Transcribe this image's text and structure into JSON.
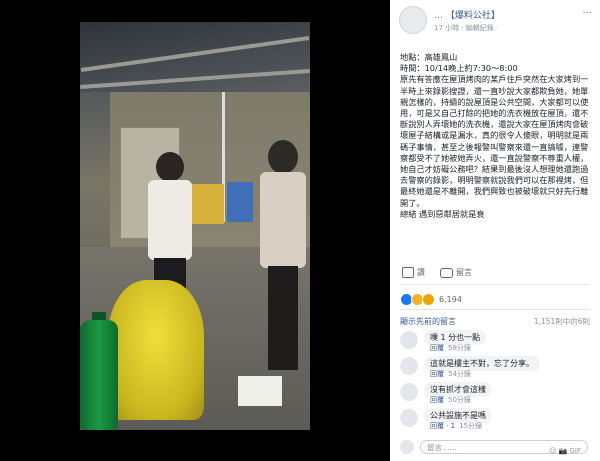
{
  "page": {
    "name": "Facebook photo/video viewer"
  },
  "header": {
    "page_name": "【爆料公社】",
    "blurred_prefix": "…",
    "meta": "17 小時 · 編輯紀錄 · ",
    "more": "···"
  },
  "post": {
    "text": "地點：高雄鳳山\n時間：10/14晚上約7:30～8:00\n原先有答應在屋頂烤肉的某戶住戶突然在大家烤到一半時上來錄影搜證，還一直吵說大家都欺負她，她單親怎樣的，持續的說屋頂是公共空間，大家都可以使用，可是又自己打餘的把她的洗衣機放在屋頂，還不斷說別人弄壞她的洗衣機，還說大家在屋頂烤肉會破壞屋子結構或是漏水，真的很令人傻眼，明明就是兩碼子事情，甚至之後報警叫警察來還一直搞噱，連警察都受不了她被她弄火，還一直說警察不尊重人權，她自己才妨礙公務吧？結果到最後沒人想理她還跑過去警察的錄影，明明警察就說我們可以在那裡烤，但最終她還是不離開，我們興致也被破壞就只好先行離開了。\n總結 遇到惡鄰居就是衰"
  },
  "actions": {
    "like": "讚",
    "comment": "留言"
  },
  "reactions": {
    "count": "6,194",
    "colors": {
      "like": "#1877f2",
      "wow": "#f7b125",
      "haha": "#f7b125"
    }
  },
  "comments_section": {
    "previous": "顯示先前的留言",
    "count": "1,151則中的6則"
  },
  "comments": [
    {
      "text": "噗 1 分也一點",
      "reply": "回覆",
      "time": "58分鐘"
    },
    {
      "text": "這就是樓主不對，忘了分享。",
      "reply": "回覆",
      "time": "54分鐘"
    },
    {
      "text": "沒有抓才會這樣",
      "reply": "回覆",
      "time": "50分鐘"
    },
    {
      "text": "公共設施不是嗎",
      "reply": "回覆 · 1",
      "time": "15分鐘"
    }
  ],
  "input": {
    "placeholder": "留言……",
    "icons": "☺ 📷 GIF"
  }
}
